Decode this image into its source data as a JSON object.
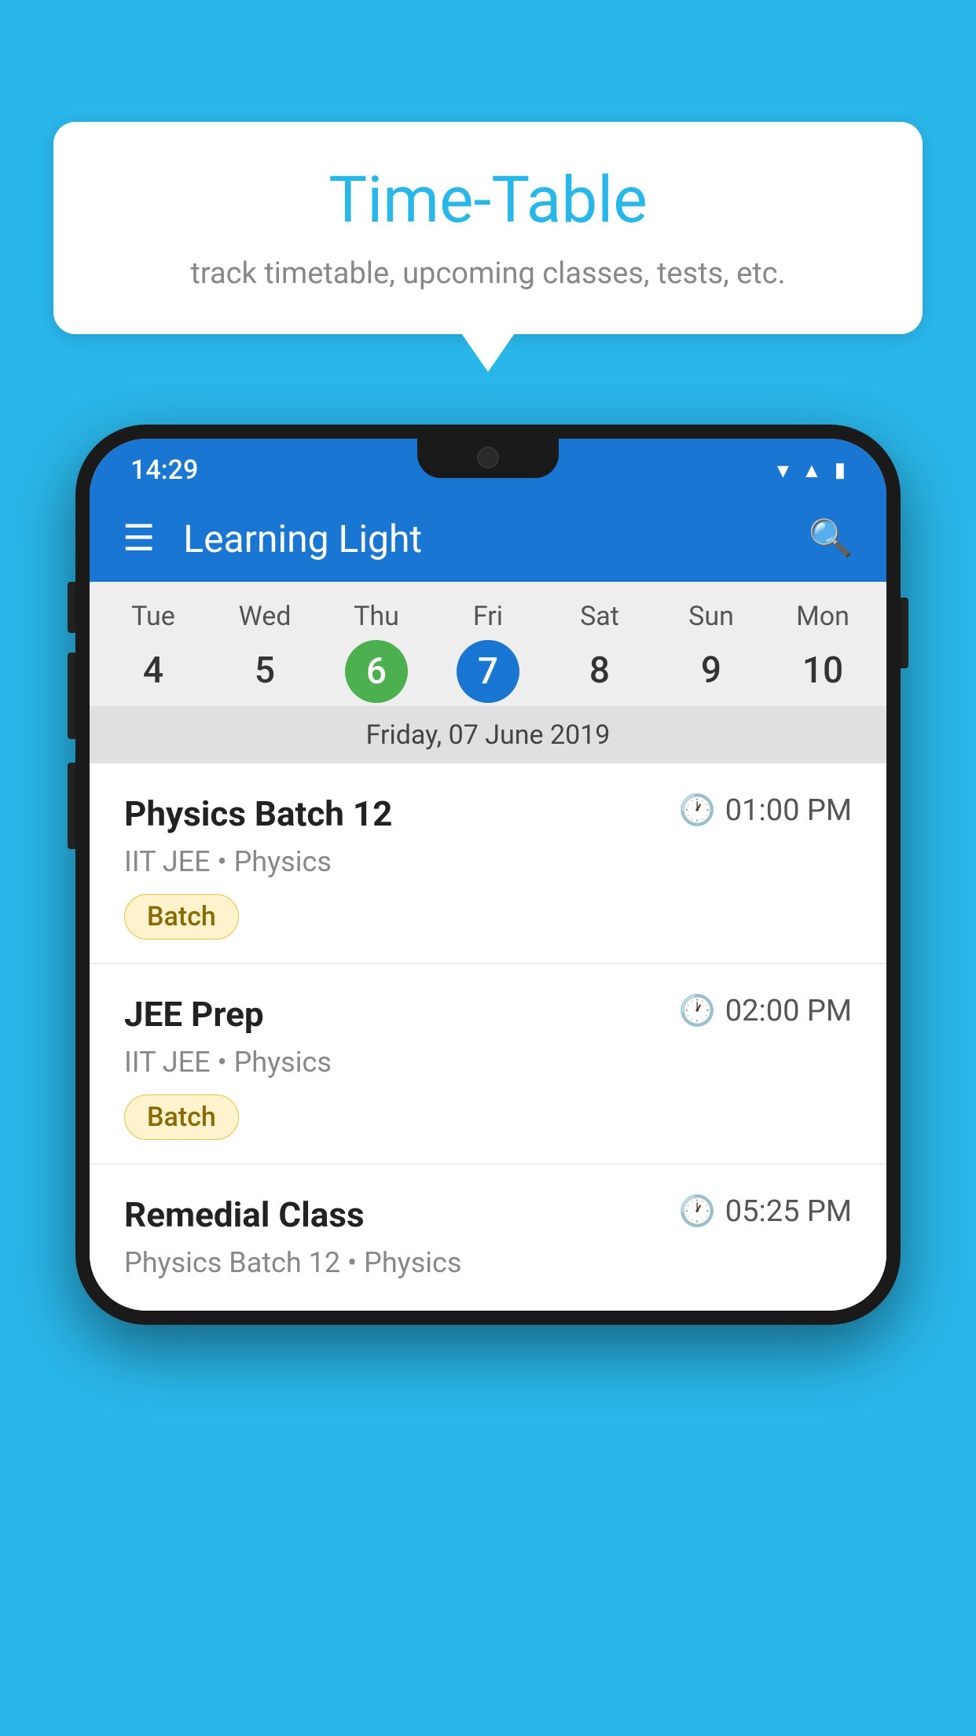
{
  "background": {
    "color": "#29B6E8"
  },
  "bubble": {
    "title": "Time-Table",
    "subtitle": "track timetable, upcoming classes, tests, etc."
  },
  "phone": {
    "status_bar": {
      "time": "14:29"
    },
    "app_bar": {
      "title": "Learning Light"
    },
    "calendar": {
      "days": [
        {
          "label": "Tue",
          "num": "4"
        },
        {
          "label": "Wed",
          "num": "5"
        },
        {
          "label": "Thu",
          "num": "6",
          "state": "today"
        },
        {
          "label": "Fri",
          "num": "7",
          "state": "selected"
        },
        {
          "label": "Sat",
          "num": "8"
        },
        {
          "label": "Sun",
          "num": "9"
        },
        {
          "label": "Mon",
          "num": "10"
        }
      ],
      "selected_date": "Friday, 07 June 2019"
    },
    "schedule": [
      {
        "name": "Physics Batch 12",
        "time": "01:00 PM",
        "sub": "IIT JEE • Physics",
        "badge": "Batch"
      },
      {
        "name": "JEE Prep",
        "time": "02:00 PM",
        "sub": "IIT JEE • Physics",
        "badge": "Batch"
      },
      {
        "name": "Remedial Class",
        "time": "05:25 PM",
        "sub": "Physics Batch 12 • Physics",
        "badge": null
      }
    ]
  }
}
